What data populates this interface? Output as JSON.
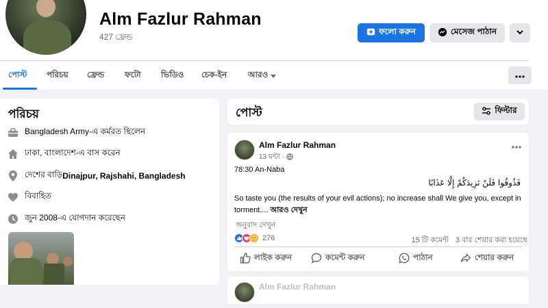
{
  "profile": {
    "name": "Alm Fazlur Rahman",
    "friends": "427 ফ্রেন্ড",
    "follow_label": "ফলো করুন",
    "message_label": "মেসেজ পাঠান"
  },
  "tabs": [
    {
      "label": "পোস্ট",
      "active": true
    },
    {
      "label": "পরিচয়"
    },
    {
      "label": "ফ্রেন্ড"
    },
    {
      "label": "ফটো"
    },
    {
      "label": "ভিডিও"
    },
    {
      "label": "চেক-ইন"
    },
    {
      "label": "আরও"
    }
  ],
  "intro": {
    "title": "পরিচয়",
    "work": "Bangladesh Army-এ কর্মরত ছিলেন",
    "lives": "ঢাকা, বাংলাদেশ-এ বাস করেন",
    "from_prefix": "দেশের বাড়ি ",
    "from_place": "Dinajpur, Rajshahi, Bangladesh",
    "relationship": "বিবাহিত",
    "joined": "জুন 2008-এ যোগদান করেছেন"
  },
  "posts_header": {
    "title": "পোস্ট",
    "filter_label": "ফিল্টার"
  },
  "post": {
    "author": "Alm Fazlur Rahman",
    "time": "13 ঘন্টা ·",
    "reference": "78:30 An-Naba",
    "arabic": "فَذُوقُوا فَلَنْ نَزِيدَكُمْ إِلَّا عَذَابًا",
    "body_line1": "So taste you (the results of your evil actions); no increase shall We give you, except in",
    "body_line2": "torment.... ",
    "see_more": "আরও দেখুন",
    "translate": "অনুবাদ দেখুন",
    "reaction_count": "276",
    "comments": "15 টি কমেন্ট",
    "shares": "3 বার শেয়ার করা হয়েছে",
    "actions": {
      "like": "লাইক করুন",
      "comment": "কমেন্ট করুন",
      "send": "পাঠান",
      "share": "শেয়ার করুন"
    }
  },
  "post2": {
    "author": "Alm Fazlur Rahman"
  },
  "colors": {
    "accent": "#1b74e4",
    "background": "#f0f2f5",
    "text_secondary": "#65676b"
  }
}
